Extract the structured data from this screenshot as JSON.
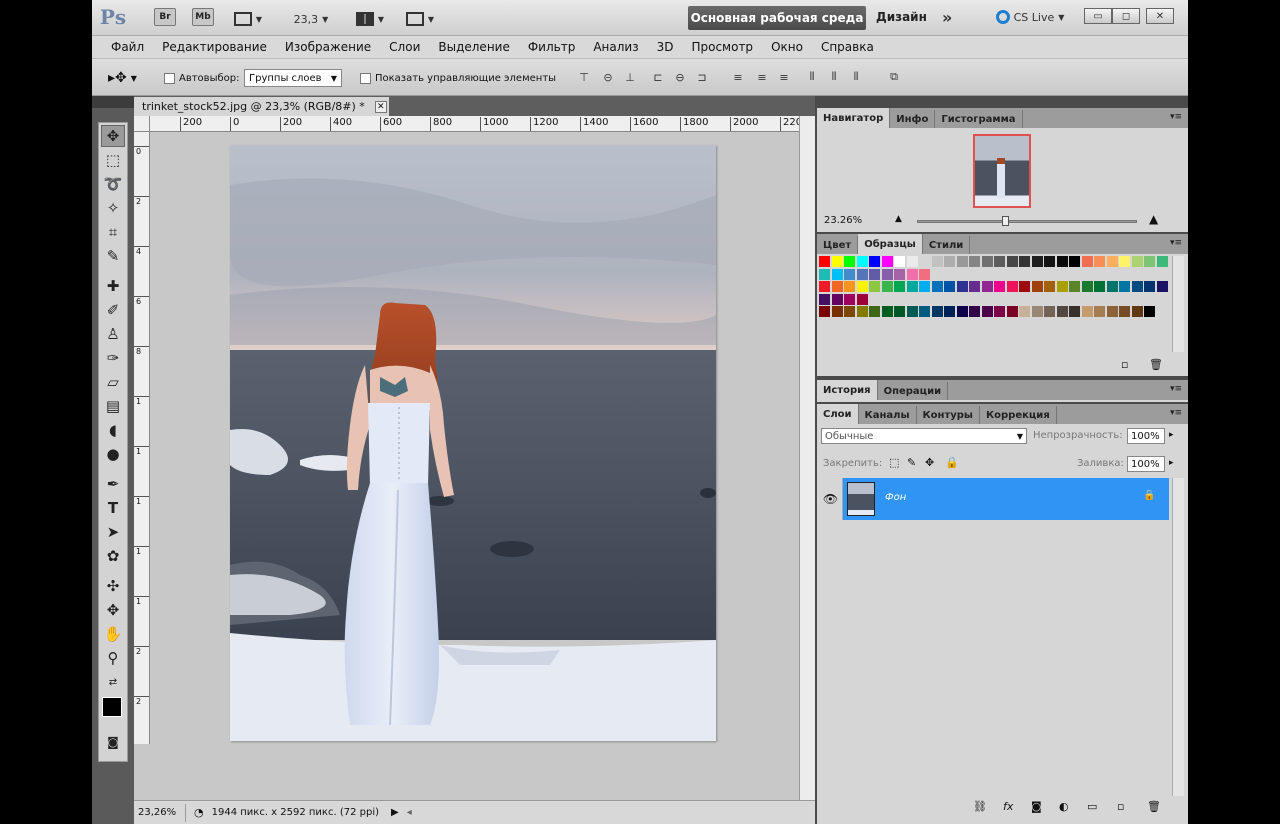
{
  "titlebar": {
    "app_logo": "Ps",
    "bridge_label": "Br",
    "minibridge_label": "Mb",
    "zoom_value": "23,3",
    "workspace_label": "Основная рабочая среда",
    "design_label": "Дизайн",
    "more_label": "»",
    "cslive_label": "CS Live",
    "minimize_label": "▭",
    "maximize_label": "◻",
    "close_label": "✕"
  },
  "menu": [
    "Файл",
    "Редактирование",
    "Изображение",
    "Слои",
    "Выделение",
    "Фильтр",
    "Анализ",
    "3D",
    "Просмотр",
    "Окно",
    "Справка"
  ],
  "options": {
    "autoselect_label": "Автовыбор:",
    "autoselect_value": "Группы слоев",
    "show_controls_label": "Показать управляющие элементы"
  },
  "document": {
    "tab_title": "trinket_stock52.jpg @ 23,3% (RGB/8#) *",
    "close": "✕",
    "ruler_labels": [
      "200",
      "0",
      "200",
      "400",
      "600",
      "800",
      "1000",
      "1200",
      "1400",
      "1600",
      "1800",
      "2000",
      "220"
    ],
    "ruler_v_labels": [
      "0",
      "2",
      "4",
      "6",
      "8",
      "1",
      "1",
      "1",
      "1",
      "1",
      "2",
      "2"
    ]
  },
  "status": {
    "zoom": "23,26%",
    "info": "1944 пикс. x 2592 пикс. (72 ppi)"
  },
  "navigator": {
    "tabs": [
      "Навигатор",
      "Инфо",
      "Гистограмма"
    ],
    "zoom": "23.26%"
  },
  "swatches_panel": {
    "tabs": [
      "Цвет",
      "Образцы",
      "Стили"
    ]
  },
  "history_panel": {
    "tabs": [
      "История",
      "Операции"
    ]
  },
  "layers_panel": {
    "tabs": [
      "Слои",
      "Каналы",
      "Контуры",
      "Коррекция"
    ],
    "blend_mode": "Обычные",
    "opacity_label": "Непрозрачность:",
    "opacity_value": "100%",
    "lock_label": "Закрепить:",
    "fill_label": "Заливка:",
    "fill_value": "100%",
    "layer_name": "Фон"
  },
  "colors": {
    "accent": "#3094f5",
    "workspace_btn": "#555555"
  }
}
